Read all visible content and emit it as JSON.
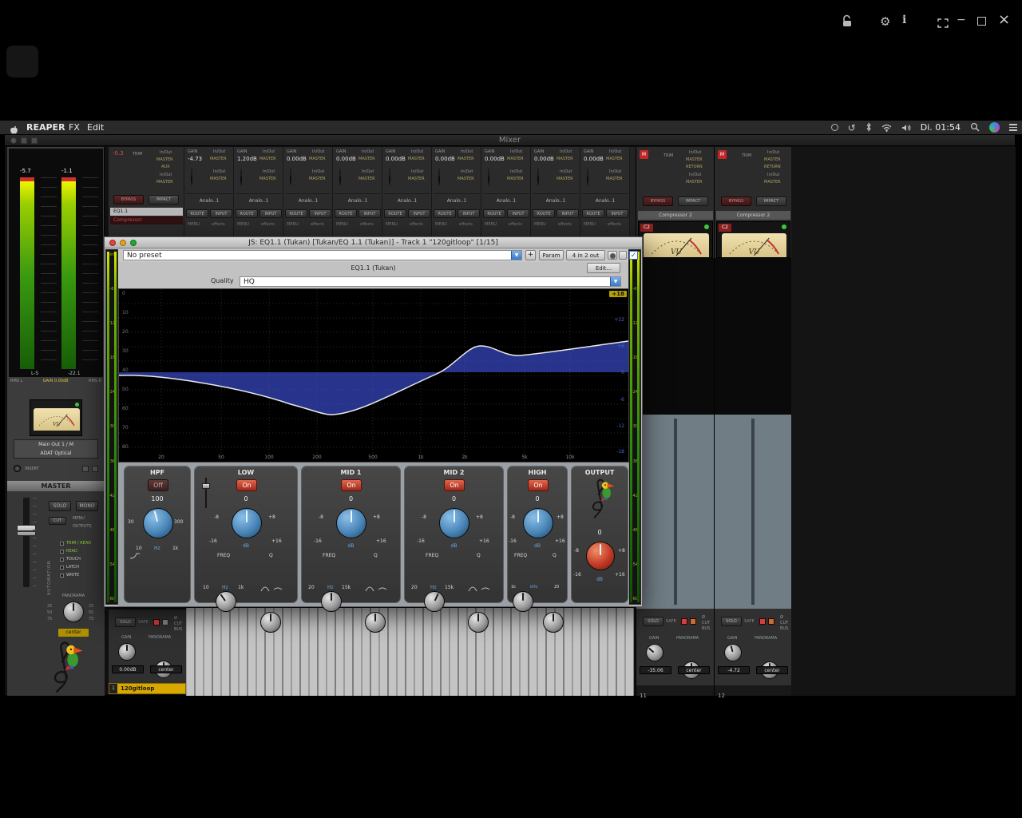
{
  "menubar": {
    "app": "REAPER",
    "menus": [
      "FX",
      "Edit"
    ],
    "clock": "Di. 01:54"
  },
  "window_controls": {
    "minimize": "−",
    "maximize": "",
    "close": "×",
    "info": "i"
  },
  "mixer": {
    "title": "Mixer",
    "master": {
      "peak_l": "-5.7",
      "peak_r": "-1.1",
      "ls": "L-S",
      "peak": "-22.1",
      "rms_l": "RMS L",
      "gain": "GAIN 0.00dB",
      "rms_r": "RMS R",
      "out_line1": "Main Out 1 / M",
      "out_line2": "ADAT Optical",
      "insert": "INSERT",
      "name": "MASTER",
      "solo": "SOLO",
      "mono": "MONO",
      "cut": "CUT",
      "menu": "MENU",
      "outputs": "OUTPUTS",
      "automation": "AUTOMATION",
      "modes": [
        "TRIM / READ",
        "READ",
        "TOUCH",
        "LATCH",
        "WRITE"
      ],
      "pan_label": "PANORAMA",
      "pan_scale": [
        "25",
        "50",
        "75"
      ],
      "pan_value": "center",
      "vu": "VU"
    },
    "labels": {
      "gain": "GAIN",
      "io": "In/Out",
      "master": "MASTER",
      "aux": "AUX",
      "trim": "TRIM",
      "return": "RETURN",
      "route": "ROUTE",
      "input": "INPUT",
      "menu": "MENU",
      "effects": "effects",
      "name": "Analo..1",
      "bypass": "BYPASS",
      "impact": "IMPACT",
      "solo": "SOLO",
      "safe": "SAFE",
      "pan": "PANORAMA",
      "mute": "M",
      "phase": "Ø",
      "cut": "CUT",
      "bus": "BUS"
    },
    "wide_strip": {
      "peak": "-0.3"
    },
    "fx_list": [
      "EQ1.1",
      "Compressor"
    ],
    "channels": [
      {
        "gain": "-4.73"
      },
      {
        "gain": "1.20dB"
      },
      {
        "gain": "0.00dB"
      },
      {
        "gain": "0.00dB"
      },
      {
        "gain": "0.00dB"
      },
      {
        "gain": "0.00dB"
      },
      {
        "gain": "0.00dB"
      },
      {
        "gain": "0.00dB"
      },
      {
        "gain": "0.00dB"
      }
    ],
    "right_strips": [
      {
        "fx": "Compressor 2",
        "c2": "C2",
        "vu": "VU",
        "gain": "-35.06",
        "pan": "center",
        "num": "11"
      },
      {
        "fx": "Compressor 2",
        "c2": "C2",
        "vu": "VU",
        "gain": "-4.72",
        "pan": "center",
        "num": "12"
      }
    ],
    "bottom_left": {
      "gain": "0.00dB",
      "pan": "center",
      "num": "1",
      "track": "120gitloop"
    }
  },
  "plugin": {
    "title": "JS: EQ1.1 (Tukan) [Tukan/EQ 1.1 (Tukan)] - Track 1 \"120gitloop\" [1/15]",
    "preset": "No preset",
    "plus": "+",
    "param": "Param",
    "io": "4 in 2 out",
    "fx_name": "EQ1.1 (Tukan)",
    "edit": "Edit...",
    "quality_label": "Quality",
    "quality": "HQ",
    "meter_scale": [
      "-inf",
      "-6",
      "-12",
      "-18",
      "-24",
      "-30",
      "-36",
      "-42",
      "-48",
      "-54",
      "-60"
    ],
    "graph": {
      "left_db": [
        "0",
        "10",
        "20",
        "30",
        "40",
        "50",
        "60",
        "70",
        "80"
      ],
      "right_db": [
        "+18",
        "+12",
        "+6",
        "0",
        "-6",
        "-12",
        "-18"
      ],
      "freqs": [
        "20",
        "50",
        "100",
        "200",
        "500",
        "1k",
        "2k",
        "5k",
        "10k"
      ]
    },
    "hpf": {
      "title": "HPF",
      "state": "Off",
      "value": "100",
      "min": "30",
      "max": "300",
      "range": [
        "10",
        "Hz",
        "1k"
      ]
    },
    "low": {
      "title": "LOW",
      "state": "On",
      "value": "0",
      "gmin": "-8",
      "gmax": "+8",
      "gmin2": "-16",
      "unit": "dB",
      "gmax2": "+16",
      "freq": "FREQ",
      "q": "Q",
      "range": [
        "10",
        "Hz",
        "1k"
      ]
    },
    "mid1": {
      "title": "MID 1",
      "state": "On",
      "value": "0",
      "gmin": "-8",
      "gmax": "+8",
      "gmin2": "-16",
      "unit": "dB",
      "gmax2": "+16",
      "freq": "FREQ",
      "q": "Q",
      "range": [
        "20",
        "Hz",
        "15k"
      ]
    },
    "mid2": {
      "title": "MID 2",
      "state": "On",
      "value": "0",
      "gmin": "-8",
      "gmax": "+8",
      "gmin2": "-16",
      "unit": "dB",
      "gmax2": "+16",
      "freq": "FREQ",
      "q": "Q",
      "range": [
        "20",
        "Hz",
        "15k"
      ]
    },
    "high": {
      "title": "HIGH",
      "state": "On",
      "value": "0",
      "gmin": "-8",
      "gmax": "+8",
      "gmin2": "-16",
      "unit": "dB",
      "gmax2": "+16",
      "freq": "FREQ",
      "q": "Q",
      "range": [
        "1k",
        "kHz",
        "20"
      ]
    },
    "output": {
      "title": "OUTPUT",
      "value": "0",
      "gmin": "-8",
      "gmax": "+8",
      "gmin2": "-16",
      "unit": "dB",
      "gmax2": "+16"
    }
  }
}
